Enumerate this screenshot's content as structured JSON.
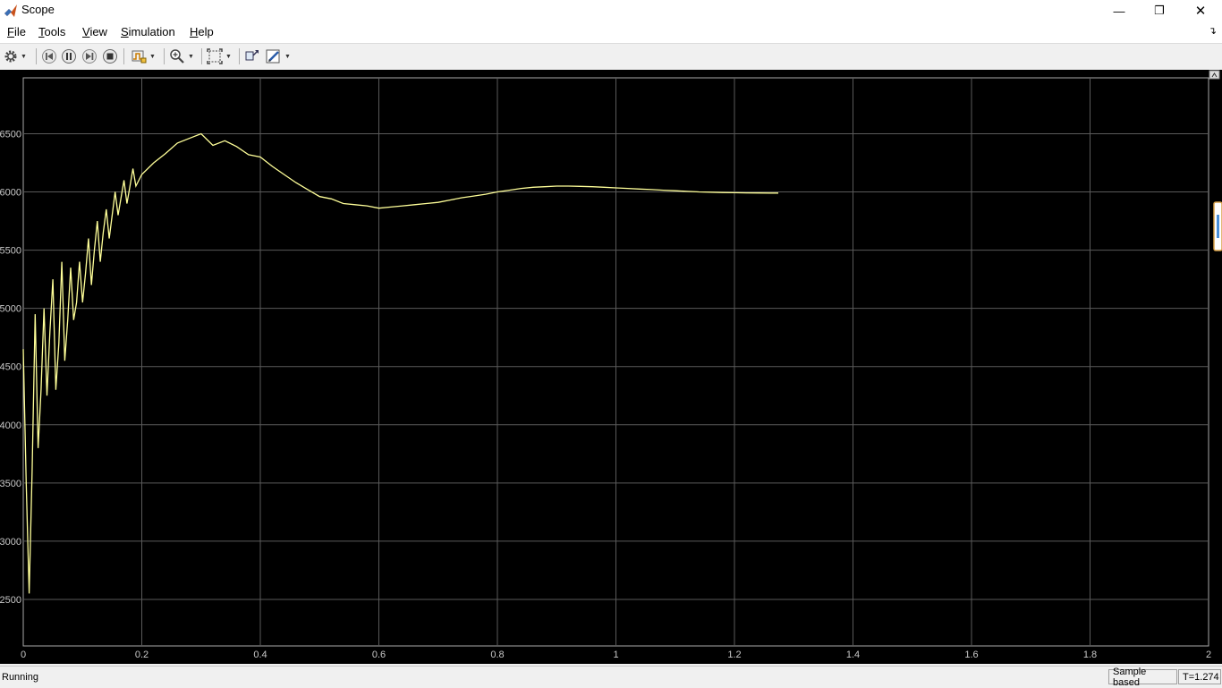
{
  "window": {
    "title": "Scope",
    "minimize_glyph": "—",
    "restore_glyph": "❐",
    "close_glyph": "✕"
  },
  "menu": {
    "items": [
      {
        "first": "F",
        "rest": "ile"
      },
      {
        "first": "T",
        "rest": "ools"
      },
      {
        "first": "V",
        "rest": "iew"
      },
      {
        "first": "S",
        "rest": "imulation"
      },
      {
        "first": "H",
        "rest": "elp"
      }
    ]
  },
  "toolbar": {
    "icons": [
      "settings-icon",
      "step-back-icon",
      "pause-icon",
      "step-forward-icon",
      "stop-icon",
      "triggers-icon",
      "zoom-in-icon",
      "fit-axes-icon",
      "highlight-simulink-block-icon",
      "properties-icon"
    ]
  },
  "colors": {
    "plot_background": "#000000",
    "grid": "#5a5a5a",
    "trace": "#ffff99",
    "tick_label": "#c8c8c8"
  },
  "chart_data": {
    "type": "line",
    "xlim": [
      0,
      2
    ],
    "ylim": [
      2100,
      6980
    ],
    "xticks": [
      "0",
      "0.2",
      "0.4",
      "0.6",
      "0.8",
      "1",
      "1.2",
      "1.4",
      "1.6",
      "1.8",
      "2"
    ],
    "yticks": [
      "2500",
      "3000",
      "3500",
      "4000",
      "4500",
      "5000",
      "5500",
      "6000",
      "6500"
    ],
    "grid": true,
    "series": [
      {
        "color": "#ffff99",
        "x": [
          0.0,
          0.005,
          0.01,
          0.015,
          0.02,
          0.025,
          0.03,
          0.035,
          0.04,
          0.045,
          0.05,
          0.055,
          0.06,
          0.065,
          0.07,
          0.075,
          0.08,
          0.085,
          0.09,
          0.095,
          0.1,
          0.105,
          0.11,
          0.115,
          0.12,
          0.125,
          0.13,
          0.135,
          0.14,
          0.145,
          0.15,
          0.155,
          0.16,
          0.165,
          0.17,
          0.175,
          0.18,
          0.185,
          0.19,
          0.2,
          0.22,
          0.24,
          0.26,
          0.28,
          0.3,
          0.32,
          0.34,
          0.36,
          0.38,
          0.4,
          0.42,
          0.44,
          0.46,
          0.48,
          0.5,
          0.52,
          0.54,
          0.56,
          0.58,
          0.6,
          0.62,
          0.64,
          0.66,
          0.68,
          0.7,
          0.72,
          0.74,
          0.76,
          0.78,
          0.8,
          0.82,
          0.84,
          0.86,
          0.88,
          0.9,
          0.92,
          0.94,
          0.96,
          0.98,
          1.0,
          1.02,
          1.04,
          1.06,
          1.08,
          1.1,
          1.12,
          1.14,
          1.16,
          1.18,
          1.2,
          1.22,
          1.24,
          1.26,
          1.274
        ],
        "y": [
          4650,
          3500,
          2550,
          3600,
          4950,
          3800,
          4300,
          5000,
          4250,
          4800,
          5250,
          4300,
          4700,
          5400,
          4550,
          4900,
          5350,
          4900,
          5050,
          5400,
          5050,
          5300,
          5600,
          5200,
          5500,
          5750,
          5400,
          5650,
          5850,
          5600,
          5800,
          6000,
          5800,
          5950,
          6100,
          5900,
          6050,
          6200,
          6050,
          6150,
          6250,
          6330,
          6420,
          6460,
          6500,
          6400,
          6440,
          6390,
          6320,
          6300,
          6220,
          6150,
          6080,
          6020,
          5960,
          5940,
          5900,
          5890,
          5880,
          5860,
          5870,
          5880,
          5890,
          5900,
          5910,
          5930,
          5950,
          5965,
          5980,
          6000,
          6015,
          6030,
          6040,
          6045,
          6050,
          6050,
          6048,
          6045,
          6040,
          6035,
          6030,
          6025,
          6020,
          6015,
          6010,
          6005,
          6000,
          5998,
          5995,
          5993,
          5992,
          5991,
          5990,
          5990
        ]
      }
    ]
  },
  "status": {
    "state": "Running",
    "mode": "Sample based",
    "time": "T=1.274"
  }
}
